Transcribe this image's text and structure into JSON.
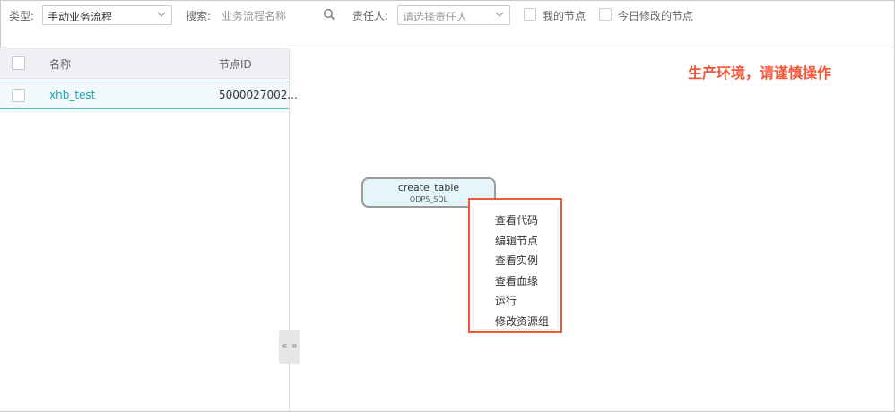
{
  "toolbar": {
    "type_label": "类型:",
    "type_value": "手动业务流程",
    "search_label": "搜索:",
    "search_placeholder": "业务流程名称",
    "owner_label": "责任人:",
    "owner_placeholder": "请选择责任人",
    "my_nodes_label": "我的节点",
    "modified_today_label": "今日修改的节点"
  },
  "table": {
    "headers": {
      "name": "名称",
      "node_id": "节点ID"
    },
    "rows": [
      {
        "name": "xhb_test",
        "node_id": "5000027002..."
      }
    ]
  },
  "canvas": {
    "warning": "生产环境，请谨慎操作",
    "node": {
      "name": "create_table",
      "type": "ODPS_SQL"
    },
    "context_menu": [
      "查看代码",
      "编辑节点",
      "查看实例",
      "查看血缘",
      "运行",
      "修改资源组"
    ]
  },
  "collapse": {
    "left": "«",
    "right": "»"
  },
  "colors": {
    "accent": "#1aa3b7",
    "warning": "#f4563c",
    "highlight_border": "#ef5a3c"
  }
}
